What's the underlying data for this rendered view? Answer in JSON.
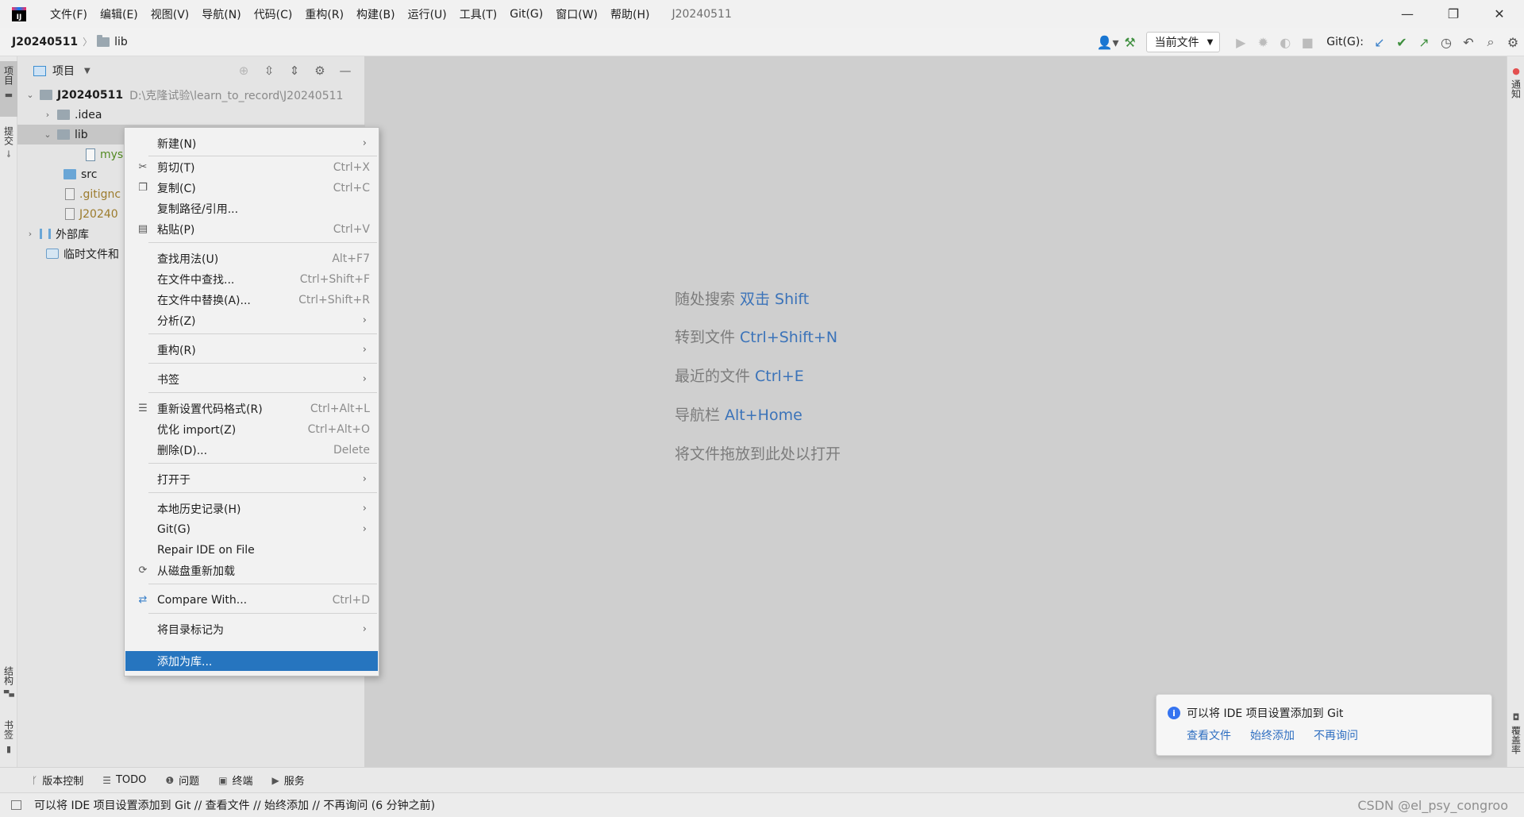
{
  "app": {
    "logo_text": "IJ",
    "menu": [
      "文件(F)",
      "编辑(E)",
      "视图(V)",
      "导航(N)",
      "代码(C)",
      "重构(R)",
      "构建(B)",
      "运行(U)",
      "工具(T)",
      "Git(G)",
      "窗口(W)",
      "帮助(H)"
    ],
    "window_title": "J20240511"
  },
  "window_controls": {
    "minimize": "—",
    "restore": "❐",
    "close": "✕"
  },
  "navbar": {
    "project": "J20240511",
    "folder": "lib",
    "run_config": "当前文件",
    "git_label": "Git(G):"
  },
  "left_stripe": {
    "project": "项目",
    "commit": "提交",
    "structure": "结构",
    "bookmarks": "书签"
  },
  "right_stripe": {
    "notifications": "通知",
    "coverage": "覆盖率"
  },
  "project_panel": {
    "title": "项目",
    "tree": [
      {
        "label": "J20240511",
        "path": "D:\\克隆试验\\learn_to_record\\J20240511"
      },
      {
        "label": ".idea"
      },
      {
        "label": "lib"
      },
      {
        "label": "mys"
      },
      {
        "label": "src"
      },
      {
        "label": ".gitignc"
      },
      {
        "label": "J20240"
      },
      {
        "label": "外部库"
      },
      {
        "label": "临时文件和"
      }
    ]
  },
  "editor_hints": [
    {
      "text": "随处搜索",
      "key": "双击 Shift"
    },
    {
      "text": "转到文件",
      "key": "Ctrl+Shift+N"
    },
    {
      "text": "最近的文件",
      "key": "Ctrl+E"
    },
    {
      "text": "导航栏",
      "key": "Alt+Home"
    },
    {
      "text": "将文件拖放到此处以打开",
      "key": ""
    }
  ],
  "context_menu": [
    {
      "label": "新建(N)",
      "shortcut": "",
      "submenu": true
    },
    {
      "label": "剪切(T)",
      "shortcut": "Ctrl+X",
      "icon": "scissors-icon"
    },
    {
      "label": "复制(C)",
      "shortcut": "Ctrl+C",
      "icon": "copy-icon"
    },
    {
      "label": "复制路径/引用...",
      "shortcut": ""
    },
    {
      "label": "粘贴(P)",
      "shortcut": "Ctrl+V",
      "icon": "paste-icon"
    },
    {
      "label": "查找用法(U)",
      "shortcut": "Alt+F7"
    },
    {
      "label": "在文件中查找...",
      "shortcut": "Ctrl+Shift+F"
    },
    {
      "label": "在文件中替换(A)...",
      "shortcut": "Ctrl+Shift+R"
    },
    {
      "label": "分析(Z)",
      "shortcut": "",
      "submenu": true
    },
    {
      "label": "重构(R)",
      "shortcut": "",
      "submenu": true
    },
    {
      "label": "书签",
      "shortcut": "",
      "submenu": true
    },
    {
      "label": "重新设置代码格式(R)",
      "shortcut": "Ctrl+Alt+L",
      "icon": "reformat-icon"
    },
    {
      "label": "优化 import(Z)",
      "shortcut": "Ctrl+Alt+O"
    },
    {
      "label": "删除(D)...",
      "shortcut": "Delete"
    },
    {
      "label": "打开于",
      "shortcut": "",
      "submenu": true
    },
    {
      "label": "本地历史记录(H)",
      "shortcut": "",
      "submenu": true
    },
    {
      "label": "Git(G)",
      "shortcut": "",
      "submenu": true
    },
    {
      "label": "Repair IDE on File",
      "shortcut": ""
    },
    {
      "label": "从磁盘重新加载",
      "shortcut": "",
      "icon": "reload-icon"
    },
    {
      "label": "Compare With...",
      "shortcut": "Ctrl+D",
      "icon": "compare-icon"
    },
    {
      "label": "将目录标记为",
      "shortcut": "",
      "submenu": true
    },
    {
      "label": "添加为库...",
      "shortcut": ""
    }
  ],
  "notification": {
    "text": "可以将 IDE 项目设置添加到 Git",
    "actions": [
      "查看文件",
      "始终添加",
      "不再询问"
    ]
  },
  "bottom_tools": [
    "版本控制",
    "TODO",
    "问题",
    "终端",
    "服务"
  ],
  "status": {
    "text": "可以将 IDE 项目设置添加到 Git // 查看文件 // 始终添加 // 不再询问 (6 分钟之前)",
    "watermark": "CSDN @el_psy_congroo"
  }
}
